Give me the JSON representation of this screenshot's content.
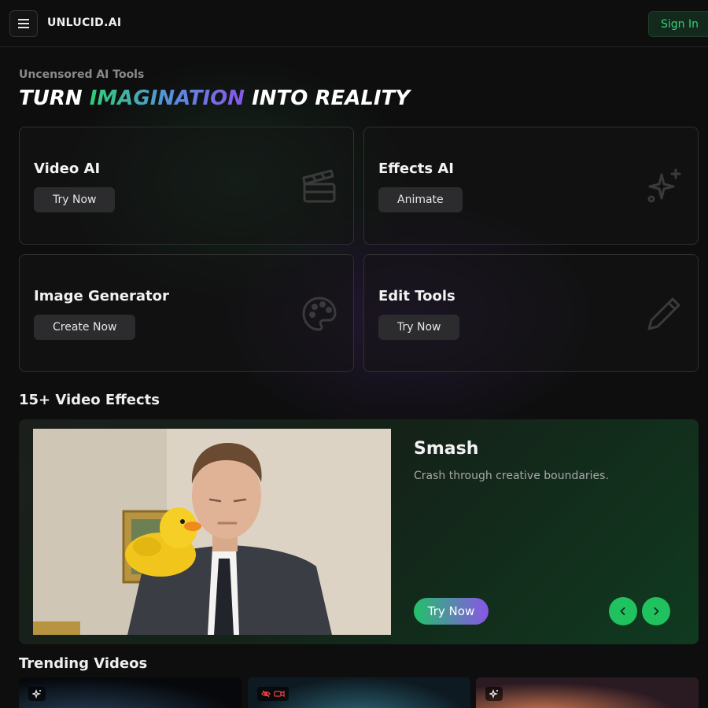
{
  "header": {
    "brand": "UNLUCID.AI",
    "signin_label": "Sign In"
  },
  "hero": {
    "eyebrow": "Uncensored AI Tools",
    "headline_start": "TURN ",
    "headline_highlight": "IMAGINATION",
    "headline_end": " INTO REALITY"
  },
  "cards": [
    {
      "title": "Video AI",
      "button": "Try Now",
      "icon": "clapperboard-icon"
    },
    {
      "title": "Effects AI",
      "button": "Animate",
      "icon": "sparkles-icon"
    },
    {
      "title": "Image Generator",
      "button": "Create Now",
      "icon": "palette-icon"
    },
    {
      "title": "Edit Tools",
      "button": "Try Now",
      "icon": "pencil-icon"
    }
  ],
  "effects_section": {
    "title": "15+ Video Effects",
    "effect_name": "Smash",
    "effect_description": "Crash through creative boundaries.",
    "cta": "Try Now"
  },
  "trending": {
    "title": "Trending Videos",
    "badges": [
      "sparkles-icon",
      "eye-off-icon video-icon",
      "sparkles-icon"
    ]
  },
  "colors": {
    "accent_green": "#20c25f",
    "accent_purple": "#8a55e8",
    "background": "#0e0e0e"
  }
}
